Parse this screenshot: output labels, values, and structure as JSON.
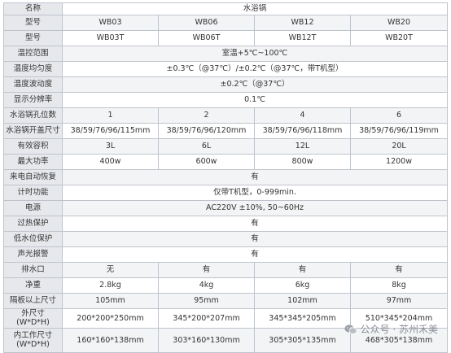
{
  "columns": [
    "WB03",
    "WB06",
    "WB12",
    "WB20"
  ],
  "rows": [
    {
      "label": "名称",
      "values": [
        "水浴锅"
      ],
      "h": 15
    },
    {
      "label": "型号",
      "values": [
        "WB03",
        "WB06",
        "WB12",
        "WB20"
      ],
      "h": 19
    },
    {
      "label": "型号",
      "values": [
        "WB03T",
        "WB06T",
        "WB12T",
        "WB20T"
      ],
      "h": 19
    },
    {
      "label": "温控范围",
      "values": [
        "室温+5℃~100℃"
      ],
      "h": 19
    },
    {
      "label": "温度均匀度",
      "values": [
        "±0.3℃（@37℃）/±0.2℃（@37℃，带T机型）"
      ],
      "h": 19
    },
    {
      "label": "温度波动度",
      "values": [
        "±0.2℃（@37℃）"
      ],
      "h": 19
    },
    {
      "label": "显示分辨率",
      "values": [
        "0.1℃"
      ],
      "h": 19
    },
    {
      "label": "水浴锅孔位数",
      "values": [
        "1",
        "2",
        "4",
        "6"
      ],
      "h": 19
    },
    {
      "label": "水浴锅开盖尺寸",
      "values": [
        "38/59/76/96/115mm",
        "38/59/76/96/120mm",
        "38/59/76/96/118mm",
        "38/59/76/96/119mm"
      ],
      "h": 19
    },
    {
      "label": "有效容积",
      "values": [
        "3L",
        "6L",
        "12L",
        "20L"
      ],
      "h": 19
    },
    {
      "label": "最大功率",
      "values": [
        "400w",
        "600w",
        "800w",
        "1200w"
      ],
      "h": 19
    },
    {
      "label": "来电自动恢复",
      "values": [
        "有"
      ],
      "h": 19
    },
    {
      "label": "计时功能",
      "values": [
        "仅带T机型，0-999min."
      ],
      "h": 19
    },
    {
      "label": "电源",
      "values": [
        "AC220V ±10%, 50~60Hz"
      ],
      "h": 19
    },
    {
      "label": "过热保护",
      "values": [
        "有"
      ],
      "h": 19
    },
    {
      "label": "低水位保护",
      "values": [
        "有"
      ],
      "h": 19
    },
    {
      "label": "声光报警",
      "values": [
        "有"
      ],
      "h": 19
    },
    {
      "label": "排水口",
      "values": [
        "无",
        "有",
        "有",
        "有"
      ],
      "h": 19
    },
    {
      "label": "净重",
      "values": [
        "2.8kg",
        "4kg",
        "6kg",
        "8kg"
      ],
      "h": 19
    },
    {
      "label": "隔板以上尺寸",
      "values": [
        "105mm",
        "95mm",
        "102mm",
        "97mm"
      ],
      "h": 19
    },
    {
      "label": "外尺寸(W*D*H)",
      "values": [
        "200*200*250mm",
        "345*200*207mm",
        "345*345*205mm",
        "510*345*204mm"
      ],
      "h": 19
    },
    {
      "label": "内工作尺寸(W*D*H)",
      "values": [
        "160*160*138mm",
        "303*160*130mm",
        "305*305*135mm",
        "468*305*138mm"
      ],
      "h": 30
    }
  ],
  "watermark": {
    "text": "公众号 · 苏州禾美",
    "icon": "wechat-icon"
  }
}
